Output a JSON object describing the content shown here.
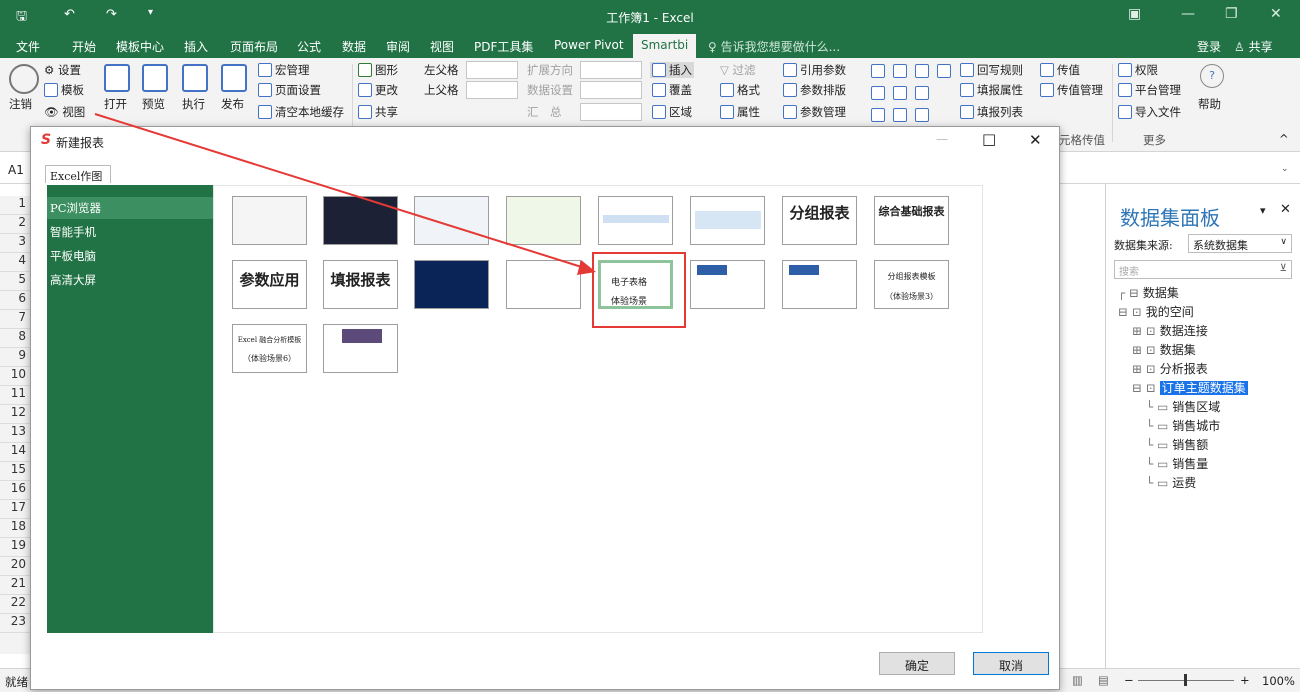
{
  "titlebar": {
    "title": "工作簿1 - Excel"
  },
  "menu": {
    "file": "文件",
    "home": "开始",
    "template": "模板中心",
    "insert": "插入",
    "layout": "页面布局",
    "formula": "公式",
    "data": "数据",
    "review": "审阅",
    "view": "视图",
    "pdf": "PDF工具集",
    "pivot": "Power Pivot",
    "smartbi": "Smartbi",
    "tell": "告诉我您想要做什么...",
    "login": "登录",
    "share": "共享"
  },
  "ribbon": {
    "logout": "注销",
    "settings": "设置",
    "template": "模板",
    "view": "视图",
    "open": "打开",
    "preview": "预览",
    "execute": "执行",
    "publish": "发布",
    "macro": "宏管理",
    "page_setup": "页面设置",
    "clear_cache": "清空本地缓存",
    "chart": "图形",
    "change": "更改",
    "share": "共享",
    "left_parent": "左父格",
    "up_parent": "上父格",
    "expand": "扩展方向",
    "data_settings": "数据设置",
    "summary": "汇　总",
    "insert": "插入",
    "overwrite": "覆盖",
    "area": "区域",
    "filter": "过滤",
    "format": "格式",
    "attr": "属性",
    "ref_param": "引用参数",
    "param_layout": "参数排版",
    "param_manage": "参数管理",
    "writeback_rule": "回写规则",
    "fill_attr": "填报属性",
    "fill_list": "填报列表",
    "pass_value": "传值",
    "pass_manage": "传值管理",
    "perm": "权限",
    "platform": "平台管理",
    "import_file": "导入文件",
    "help": "帮助",
    "cell_pass": "元格传值",
    "more": "更多"
  },
  "formula_bar": {
    "cell_ref": "A1"
  },
  "rows": [
    "1",
    "2",
    "3",
    "4",
    "5",
    "6",
    "7",
    "8",
    "9",
    "10",
    "11",
    "12",
    "13",
    "14",
    "15",
    "16",
    "17",
    "18",
    "19",
    "20",
    "21",
    "22",
    "23"
  ],
  "dialog": {
    "title": "新建报表",
    "tab": "Excel作图",
    "categories": [
      "PC浏览器",
      "智能手机",
      "平板电脑",
      "高清大屏"
    ],
    "thumbs": {
      "group_report": "分组报表",
      "composite": "综合基础报表",
      "param_app": "参数应用",
      "fill_report": "填报报表",
      "spreadsheet_1": "电子表格",
      "spreadsheet_2": "体验场景",
      "group_tpl_1": "分组报表模板",
      "group_tpl_2": "（体验场景3）",
      "excel_tpl_1": "Excel 融合分析模板",
      "excel_tpl_2": "（体验场景6）"
    },
    "ok": "确定",
    "cancel": "取消"
  },
  "panel": {
    "title": "数据集面板",
    "source_label": "数据集来源:",
    "source_value": "系统数据集",
    "search_placeholder": "搜索",
    "tree": [
      "数据集",
      "我的空间",
      "数据连接",
      "数据集",
      "分析报表",
      "订单主题数据集",
      "销售区域",
      "销售城市",
      "销售额",
      "销售量",
      "运费"
    ]
  },
  "status": {
    "ready": "就绪",
    "zoom": "100%"
  },
  "colors": {
    "excel_green": "#217346",
    "highlight_red": "#e53935",
    "selected_blue": "#1a73e8"
  }
}
